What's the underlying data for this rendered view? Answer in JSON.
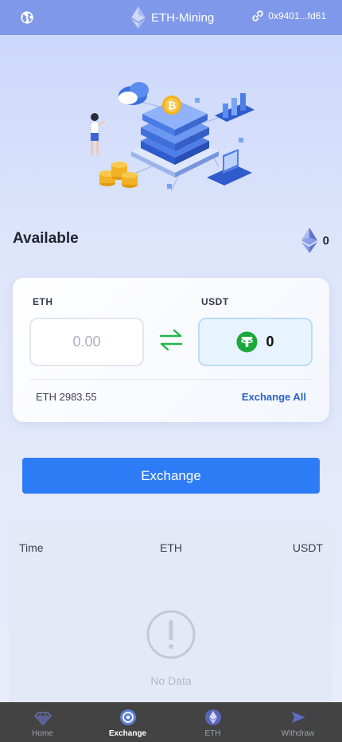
{
  "header": {
    "title": "ETH-Mining",
    "wallet_address": "0x9401...fd61",
    "icons": {
      "left": "globe-icon",
      "logo": "ethereum-icon",
      "wallet": "link-icon"
    }
  },
  "available": {
    "label": "Available",
    "value": "0",
    "icon": "ethereum-icon"
  },
  "exchange_card": {
    "from_label": "ETH",
    "from_placeholder": "0.00",
    "to_label": "USDT",
    "to_value": "0",
    "swap_icon": "swap-arrows-icon",
    "to_icon": "tether-icon",
    "balance_text": "ETH 2983.55",
    "exchange_all_label": "Exchange All"
  },
  "exchange_button_label": "Exchange",
  "records": {
    "columns": [
      "Time",
      "ETH",
      "USDT"
    ],
    "empty_text": "No Data",
    "empty_icon": "exclamation-circle-icon"
  },
  "tabbar": {
    "items": [
      {
        "label": "Home",
        "icon": "diamond-icon",
        "active": false
      },
      {
        "label": "Exchange",
        "icon": "exchange-circle-icon",
        "active": true
      },
      {
        "label": "ETH",
        "icon": "ethereum-icon",
        "active": false
      },
      {
        "label": "Withdraw",
        "icon": "send-arrow-icon",
        "active": false
      }
    ]
  },
  "colors": {
    "header_bg": "#7f98ea",
    "primary_button": "#2e7bf6",
    "link_blue": "#2b63c8",
    "swap_green": "#22b64a",
    "tether_green": "#1aa83a",
    "tabbar_bg": "#434343"
  }
}
